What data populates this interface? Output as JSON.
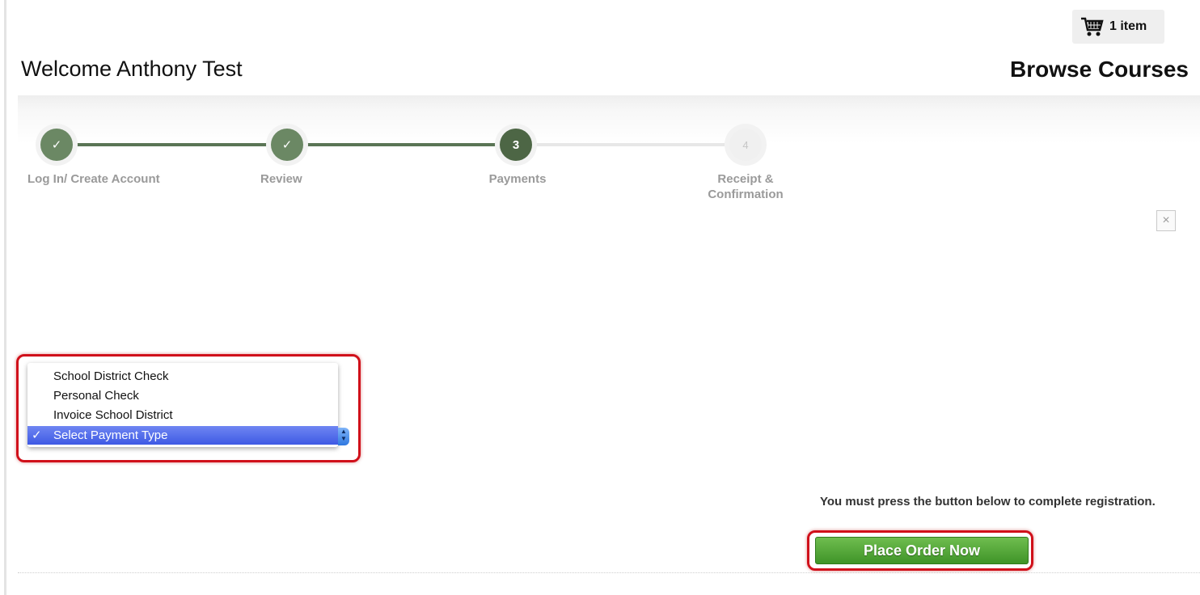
{
  "header": {
    "cart_label": "1 item",
    "welcome": "Welcome Anthony Test",
    "browse_link": "Browse Courses"
  },
  "steps": [
    {
      "number": "✓",
      "label": "Log In/ Create Account",
      "state": "done"
    },
    {
      "number": "✓",
      "label": "Review",
      "state": "done"
    },
    {
      "number": "3",
      "label": "Payments",
      "state": "current"
    },
    {
      "number": "4",
      "label_line1": "Receipt &",
      "label_line2": "Confirmation",
      "state": "todo"
    }
  ],
  "close_symbol": "×",
  "payment_dropdown": {
    "options": [
      "School District Check",
      "Personal Check",
      "Invoice School District"
    ],
    "selected": "Select Payment Type",
    "check_symbol": "✓"
  },
  "order": {
    "notice": "You must press the button below to complete registration.",
    "button_label": "Place Order Now"
  },
  "colors": {
    "step_done": "#6b8864",
    "step_current": "#4d6645",
    "highlight_red": "#d0101a",
    "button_green": "#4fa52f",
    "select_blue": "#4a64e8"
  },
  "icons": {
    "cart": "shopping-cart-icon",
    "close": "close-icon",
    "check": "checkmark-icon"
  }
}
